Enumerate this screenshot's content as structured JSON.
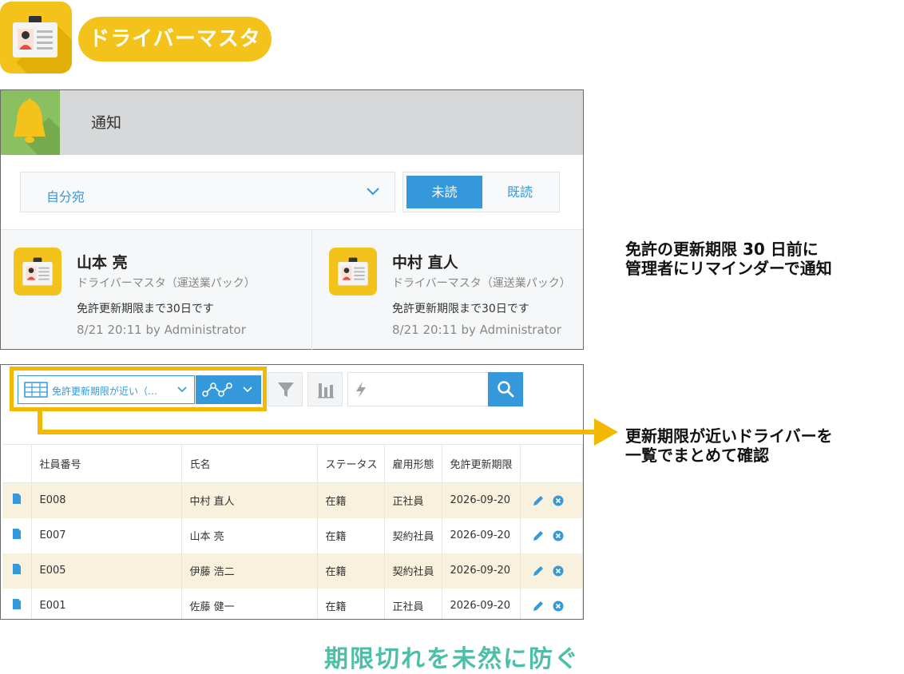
{
  "header": {
    "title": "ドライバーマスタ",
    "icon": "id-card-icon",
    "brand_color": "#f3c21b"
  },
  "notification_panel": {
    "title": "通知",
    "icon": "bell-icon",
    "filter_value": "自分宛",
    "toggle": {
      "unread": "未読",
      "read": "既読",
      "active": "unread"
    },
    "cards": [
      {
        "name": "山本 亮",
        "app": "ドライバーマスタ（運送業パック）",
        "message": "免許更新期限まで30日です",
        "meta": "8/21 20:11  by Administrator"
      },
      {
        "name": "中村 直人",
        "app": "ドライバーマスタ（運送業パック）",
        "message": "免許更新期限まで30日です",
        "meta": "8/21 20:11  by Administrator"
      }
    ]
  },
  "captions": {
    "notify_line1": "免許の更新期限 30 日前に",
    "notify_line2": "管理者にリマインダーで通知",
    "list_line1": "更新期限が近いドライバーを",
    "list_line2": "一覧でまとめて確認"
  },
  "list_panel": {
    "view_name": "免許更新期限が近い（…",
    "search_placeholder": "",
    "columns": [
      "社員番号",
      "氏名",
      "ステータス",
      "雇用形態",
      "免許更新期限"
    ],
    "rows": [
      {
        "id": "E008",
        "name": "中村 直人",
        "status": "在籍",
        "type": "正社員",
        "expiry": "2026-09-20"
      },
      {
        "id": "E007",
        "name": "山本 亮",
        "status": "在籍",
        "type": "契約社員",
        "expiry": "2026-09-20"
      },
      {
        "id": "E005",
        "name": "伊藤 浩二",
        "status": "在籍",
        "type": "契約社員",
        "expiry": "2026-09-20"
      },
      {
        "id": "E001",
        "name": "佐藤 健一",
        "status": "在籍",
        "type": "正社員",
        "expiry": "2026-09-20"
      }
    ],
    "highlight_color": "#f3b800",
    "accent_color": "#3498db"
  },
  "slogan": "期限切れを未然に防ぐ",
  "slogan_color": "#4dbfa8"
}
